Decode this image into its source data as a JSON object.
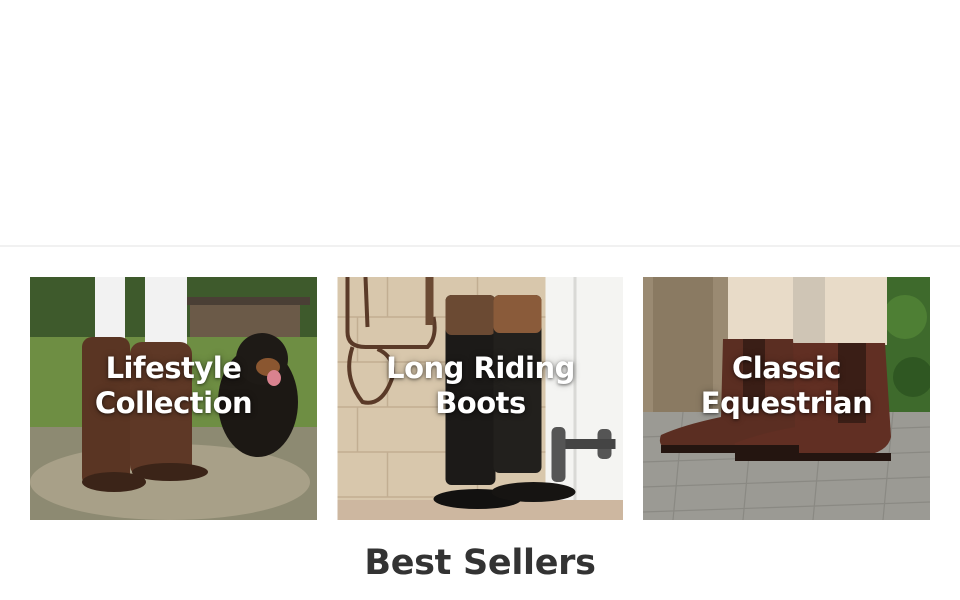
{
  "categories": [
    {
      "label_line1": "Lifestyle",
      "label_line2": "Collection"
    },
    {
      "label_line1": "Long Riding",
      "label_line2": "Boots"
    },
    {
      "label_line1": "Classic",
      "label_line2": "Equestrian"
    }
  ],
  "best_sellers": {
    "title": "Best Sellers"
  }
}
